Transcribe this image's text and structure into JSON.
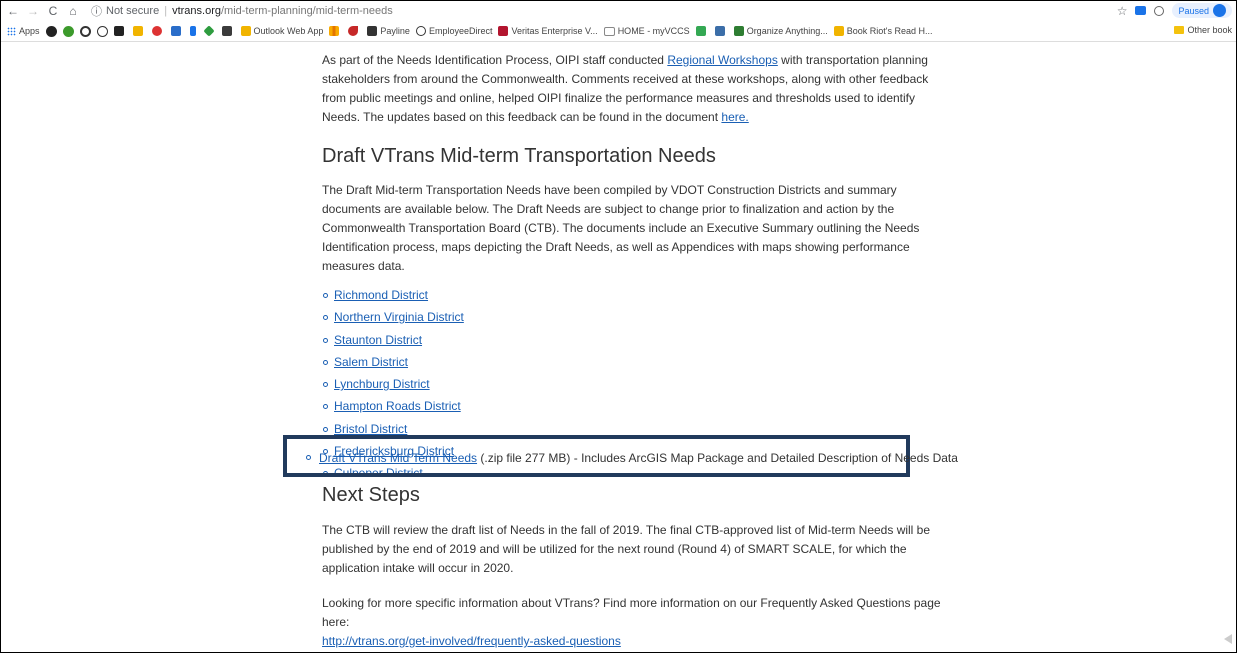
{
  "browser": {
    "security_label": "Not secure",
    "url_host": "vtrans.org",
    "url_path": "/mid-term-planning/mid-term-needs",
    "paused_label": "Paused"
  },
  "bookmarks": {
    "apps": "Apps",
    "outlook": "Outlook Web App",
    "payline": "Payline",
    "employee_direct": "EmployeeDirect",
    "veritas": "Veritas Enterprise V...",
    "home_myvccs": "HOME - myVCCS",
    "organize": "Organize Anything...",
    "book_riot": "Book Riot's Read H...",
    "other": "Other book"
  },
  "intro": {
    "text_before": "As part of the Needs Identification Process, OIPI staff conducted ",
    "workshops_link": "Regional Workshops",
    "text_after": " with transportation planning stakeholders from around the Commonwealth. Comments received at these workshops, along with other feedback from public meetings and online, helped OIPI finalize the performance measures and thresholds used to identify Needs. The updates based on this feedback can be found in the document ",
    "here_link": "here."
  },
  "needs": {
    "heading": "Draft VTrans Mid-term Transportation Needs",
    "paragraph": "The Draft Mid-term Transportation Needs have been compiled by VDOT Construction Districts and summary documents are available below. The Draft Needs are subject to change prior to finalization and action by the Commonwealth Transportation Board (CTB). The documents include an Executive Summary outlining the Needs Identification process, maps depicting the Draft Needs, as well as Appendices with maps showing performance measures data.",
    "districts": [
      "Richmond District",
      "Northern Virginia District",
      "Staunton District",
      "Salem District",
      "Lynchburg District",
      "Hampton Roads District",
      "Bristol District",
      "Fredericksburg District",
      "Culpeper District"
    ],
    "zip_link": "Draft VTrans Mid Term Needs",
    "zip_desc": " (.zip file 277 MB) - Includes ArcGIS Map Package and Detailed Description of Needs Data"
  },
  "next_steps": {
    "heading": "Next Steps",
    "paragraph1": "The CTB will review the draft list of Needs in the fall of 2019. The final CTB-approved list of Mid-term Needs will be published by the end of 2019 and will be utilized for the next round (Round 4) of SMART SCALE, for which the application intake will occur in 2020.",
    "paragraph2": "Looking for more specific information about VTrans? Find more information on our Frequently Asked Questions page here:",
    "faq_link": "http://vtrans.org/get-involved/frequently-asked-questions"
  }
}
